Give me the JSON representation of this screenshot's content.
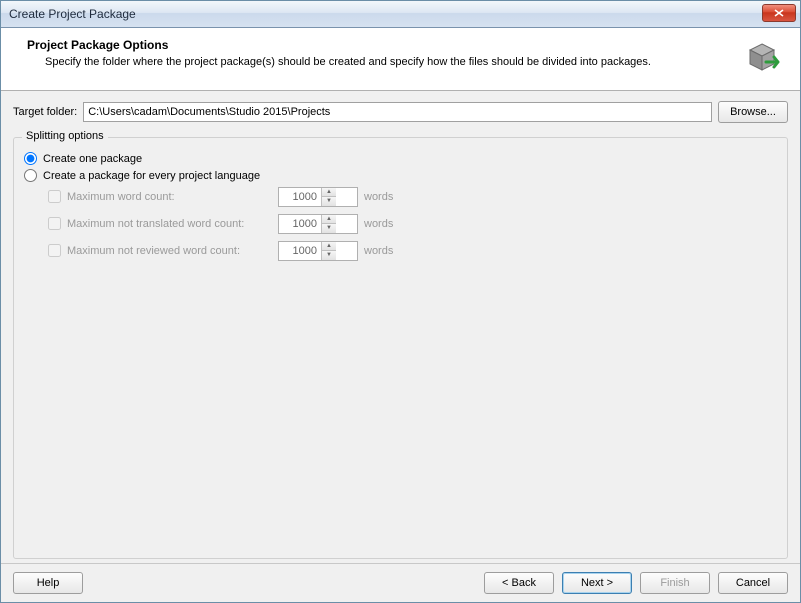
{
  "window": {
    "title": "Create Project Package"
  },
  "header": {
    "title": "Project Package Options",
    "description": "Specify the folder where the project package(s) should be created and specify how the files should be divided into packages."
  },
  "target": {
    "label": "Target folder:",
    "value": "C:\\Users\\cadam\\Documents\\Studio 2015\\Projects",
    "browse": "Browse..."
  },
  "splitting": {
    "legend": "Splitting options",
    "create_one": "Create one package",
    "create_per_lang": "Create a package for every project language",
    "max_word": "Maximum word count:",
    "max_nottrans": "Maximum not translated word count:",
    "max_notrev": "Maximum not reviewed word count:",
    "val_word": "1000",
    "val_nottrans": "1000",
    "val_notrev": "1000",
    "unit": "words"
  },
  "footer": {
    "help": "Help",
    "back": "< Back",
    "next": "Next >",
    "finish": "Finish",
    "cancel": "Cancel"
  }
}
